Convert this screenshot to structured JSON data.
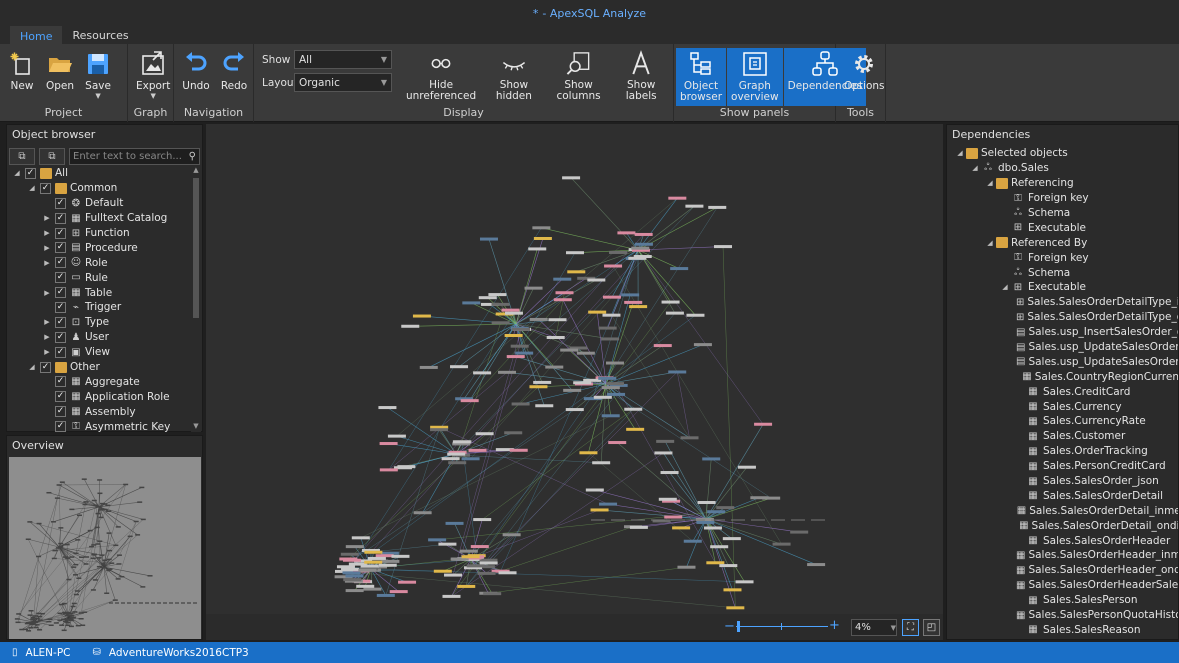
{
  "window": {
    "title_prefix": "*",
    "title": "- ApexSQL Analyze"
  },
  "tabs": [
    {
      "label": "Home"
    },
    {
      "label": "Resources"
    }
  ],
  "ribbon": {
    "project": {
      "label": "Project",
      "new": "New",
      "open": "Open",
      "save": "Save"
    },
    "graph": {
      "label": "Graph",
      "export": "Export"
    },
    "navigation": {
      "label": "Navigation",
      "undo": "Undo",
      "redo": "Redo"
    },
    "display": {
      "label": "Display",
      "show_label": "Show",
      "show_value": "All",
      "layout_label": "Layout",
      "layout_value": "Organic",
      "hide_unreferenced": "Hide unreferenced",
      "show_hidden": "Show hidden",
      "show_columns": "Show columns",
      "show_labels": "Show labels"
    },
    "show_panels": {
      "label": "Show panels",
      "object_browser": [
        "Object",
        "browser"
      ],
      "graph_overview": [
        "Graph",
        "overview"
      ],
      "dependencies": "Dependencies"
    },
    "tools": {
      "label": "Tools",
      "options": "Options"
    }
  },
  "object_browser": {
    "title": "Object browser",
    "search_placeholder": "Enter text to search...",
    "items": [
      {
        "label": "All",
        "level": 0,
        "exp": "◢",
        "type": "folder"
      },
      {
        "label": "Common",
        "level": 1,
        "exp": "◢",
        "type": "folder"
      },
      {
        "label": "Default",
        "level": 2,
        "exp": "",
        "type": "default"
      },
      {
        "label": "Fulltext Catalog",
        "level": 2,
        "exp": "▶",
        "type": "grid"
      },
      {
        "label": "Function",
        "level": 2,
        "exp": "▶",
        "type": "func"
      },
      {
        "label": "Procedure",
        "level": 2,
        "exp": "▶",
        "type": "proc"
      },
      {
        "label": "Role",
        "level": 2,
        "exp": "▶",
        "type": "role"
      },
      {
        "label": "Rule",
        "level": 2,
        "exp": "",
        "type": "rule"
      },
      {
        "label": "Table",
        "level": 2,
        "exp": "▶",
        "type": "table"
      },
      {
        "label": "Trigger",
        "level": 2,
        "exp": "",
        "type": "trigger"
      },
      {
        "label": "Type",
        "level": 2,
        "exp": "▶",
        "type": "type"
      },
      {
        "label": "User",
        "level": 2,
        "exp": "▶",
        "type": "user"
      },
      {
        "label": "View",
        "level": 2,
        "exp": "▶",
        "type": "view"
      },
      {
        "label": "Other",
        "level": 1,
        "exp": "◢",
        "type": "folder"
      },
      {
        "label": "Aggregate",
        "level": 2,
        "exp": "",
        "type": "grid"
      },
      {
        "label": "Application Role",
        "level": 2,
        "exp": "",
        "type": "grid"
      },
      {
        "label": "Assembly",
        "level": 2,
        "exp": "",
        "type": "grid"
      },
      {
        "label": "Asymmetric Key",
        "level": 2,
        "exp": "",
        "type": "key"
      }
    ]
  },
  "overview": {
    "title": "Overview"
  },
  "graph_footer": {
    "zoom_value": "4%"
  },
  "dependencies": {
    "title": "Dependencies",
    "items": [
      {
        "label": "Selected objects",
        "level": 0,
        "exp": "◢",
        "type": "folder"
      },
      {
        "label": "dbo.Sales",
        "level": 1,
        "exp": "◢",
        "type": "schema"
      },
      {
        "label": "Referencing",
        "level": 2,
        "exp": "◢",
        "type": "folder"
      },
      {
        "label": "Foreign key",
        "level": 3,
        "exp": "",
        "type": "key"
      },
      {
        "label": "Schema",
        "level": 3,
        "exp": "",
        "type": "schema"
      },
      {
        "label": "Executable",
        "level": 3,
        "exp": "",
        "type": "func"
      },
      {
        "label": "Referenced By",
        "level": 2,
        "exp": "◢",
        "type": "folder"
      },
      {
        "label": "Foreign key",
        "level": 3,
        "exp": "",
        "type": "key"
      },
      {
        "label": "Schema",
        "level": 3,
        "exp": "",
        "type": "schema"
      },
      {
        "label": "Executable",
        "level": 3,
        "exp": "◢",
        "type": "func"
      },
      {
        "label": "Sales.SalesOrderDetailType_inmem",
        "level": 4,
        "exp": "",
        "type": "func"
      },
      {
        "label": "Sales.SalesOrderDetailType_ondisk",
        "level": 4,
        "exp": "",
        "type": "func"
      },
      {
        "label": "Sales.usp_InsertSalesOrder_ondisk",
        "level": 4,
        "exp": "",
        "type": "proc"
      },
      {
        "label": "Sales.usp_UpdateSalesOrderShip",
        "level": 4,
        "exp": "",
        "type": "proc"
      },
      {
        "label": "Sales.usp_UpdateSalesOrderShip",
        "level": 4,
        "exp": "",
        "type": "proc"
      },
      {
        "label": "Sales.CountryRegionCurrency",
        "level": 4,
        "exp": "",
        "type": "table"
      },
      {
        "label": "Sales.CreditCard",
        "level": 4,
        "exp": "",
        "type": "table"
      },
      {
        "label": "Sales.Currency",
        "level": 4,
        "exp": "",
        "type": "table"
      },
      {
        "label": "Sales.CurrencyRate",
        "level": 4,
        "exp": "",
        "type": "table"
      },
      {
        "label": "Sales.Customer",
        "level": 4,
        "exp": "",
        "type": "table"
      },
      {
        "label": "Sales.OrderTracking",
        "level": 4,
        "exp": "",
        "type": "table"
      },
      {
        "label": "Sales.PersonCreditCard",
        "level": 4,
        "exp": "",
        "type": "table"
      },
      {
        "label": "Sales.SalesOrder_json",
        "level": 4,
        "exp": "",
        "type": "table"
      },
      {
        "label": "Sales.SalesOrderDetail",
        "level": 4,
        "exp": "",
        "type": "table"
      },
      {
        "label": "Sales.SalesOrderDetail_inmem",
        "level": 4,
        "exp": "",
        "type": "table"
      },
      {
        "label": "Sales.SalesOrderDetail_ondisk",
        "level": 4,
        "exp": "",
        "type": "table"
      },
      {
        "label": "Sales.SalesOrderHeader",
        "level": 4,
        "exp": "",
        "type": "table"
      },
      {
        "label": "Sales.SalesOrderHeader_inmem",
        "level": 4,
        "exp": "",
        "type": "table"
      },
      {
        "label": "Sales.SalesOrderHeader_ondisk",
        "level": 4,
        "exp": "",
        "type": "table"
      },
      {
        "label": "Sales.SalesOrderHeaderSalesReas",
        "level": 4,
        "exp": "",
        "type": "table"
      },
      {
        "label": "Sales.SalesPerson",
        "level": 4,
        "exp": "",
        "type": "table"
      },
      {
        "label": "Sales.SalesPersonQuotaHistory",
        "level": 4,
        "exp": "",
        "type": "table"
      },
      {
        "label": "Sales.SalesReason",
        "level": 4,
        "exp": "",
        "type": "table"
      }
    ]
  },
  "status": {
    "machine": "ALEN-PC",
    "database": "AdventureWorks2016CTP3"
  },
  "colors": {
    "accent": "#1a6fc7",
    "link": "#4da3ff",
    "folder": "#d9a441",
    "edge_green": "#7fbf5f",
    "edge_blue": "#4aa0c8"
  }
}
